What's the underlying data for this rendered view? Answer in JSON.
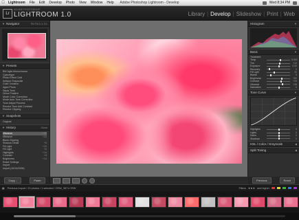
{
  "menubar": {
    "items": [
      "Lightroom",
      "File",
      "Edit",
      "Develop",
      "Photo",
      "View",
      "Window",
      "Help"
    ],
    "window_title": "Adobe Photoshop Lightroom - Develop",
    "clock": "Wed 8:34 PM"
  },
  "header": {
    "logo_letters": "Lr",
    "brand_small": "ADOBE PHOTOSHOP",
    "brand": "LIGHTROOM 1.0",
    "modules": [
      "Library",
      "Develop",
      "Slideshow",
      "Print",
      "Web"
    ],
    "active_module": "Develop"
  },
  "left_panel": {
    "navigator_label": "Navigator",
    "navigator_zoom": [
      "Fit",
      "Fill",
      "1:1",
      "3:1"
    ],
    "presets_label": "Presets",
    "presets": [
      "BW Agfa Monochrome",
      "Cyanotype",
      "Photo Effect Cold",
      "Antique Grayscale",
      "Color Creative",
      "Aged Photo",
      "Sepia Tone",
      "Direct Positive",
      "Mode Color Correction",
      "Mode Auto Tone Correction",
      "Tone Adjust Process",
      "Recolor Tone Add Contrast",
      "Recolor Clipping"
    ],
    "snapshots_label": "Snapshots",
    "snapshots": [
      "Original"
    ],
    "history_label": "History",
    "history_clear": "Clear",
    "history": [
      {
        "label": "Vibrance",
        "value": "+28"
      },
      {
        "label": "Vibrance",
        "value": "+20"
      },
      {
        "label": "Black Clipping",
        "value": ""
      },
      {
        "label": "Shadow Detail",
        "value": "+6"
      },
      {
        "label": "Fill Light",
        "value": "+20"
      },
      {
        "label": "Fill Light",
        "value": "+6"
      },
      {
        "label": "Highlights",
        "value": "+14"
      },
      {
        "label": "Contrast",
        "value": "+8"
      },
      {
        "label": "Brightness",
        "value": "+14"
      },
      {
        "label": "Reset Settings",
        "value": ""
      },
      {
        "label": "Import",
        "value": ""
      },
      {
        "label": "Import (10/14/2006)",
        "value": ""
      }
    ],
    "copy_button": "Copy...",
    "paste_button": "Paste"
  },
  "right_panel": {
    "histogram_label": "Histogram",
    "basic_label": "Basic",
    "basic_rows": [
      {
        "label": "Treatment",
        "value": ""
      },
      {
        "label": "Temp",
        "value": "6,500",
        "pos": 0.55
      },
      {
        "label": "Tint",
        "value": "+12",
        "pos": 0.52
      },
      {
        "label": "Exposure",
        "value": "0.00",
        "pos": 0.5
      },
      {
        "label": "Recovery",
        "value": "0",
        "pos": 0.1
      },
      {
        "label": "Fill Light",
        "value": "20",
        "pos": 0.3
      },
      {
        "label": "Blacks",
        "value": "5",
        "pos": 0.15
      },
      {
        "label": "Brightness",
        "value": "+50",
        "pos": 0.62
      },
      {
        "label": "Contrast",
        "value": "+25",
        "pos": 0.58
      },
      {
        "label": "Vibrance",
        "value": "+28",
        "pos": 0.64
      },
      {
        "label": "Saturation",
        "value": "0",
        "pos": 0.5
      }
    ],
    "tone_curve_label": "Tone Curve",
    "tone_rows": [
      {
        "label": "Highlights",
        "value": "0",
        "pos": 0.5
      },
      {
        "label": "Lights",
        "value": "0",
        "pos": 0.5
      },
      {
        "label": "Darks",
        "value": "0",
        "pos": 0.5
      },
      {
        "label": "Shadows",
        "value": "0",
        "pos": 0.5
      }
    ],
    "hsl_label": "HSL / Color / Grayscale",
    "split_toning_label": "Split Toning",
    "previous_button": "Previous",
    "reset_button": "Reset"
  },
  "filmbar": {
    "breadcrumb": "Previous Import / 20 photos / 1 selected / CRW_3871.CRW",
    "filters_label": "Filters",
    "rating_label": "and higher",
    "filter_colors": [
      "#d33",
      "#dd3",
      "#3b3",
      "#37d",
      "#a3d"
    ]
  },
  "filmstrip": {
    "thumbs": [
      {
        "color": "#e84e72",
        "selected": false
      },
      {
        "color": "#f2829c",
        "selected": true
      },
      {
        "color": "#d44a6a",
        "selected": false
      },
      {
        "color": "#e96a8a",
        "selected": false
      },
      {
        "color": "#b73a56",
        "selected": false
      },
      {
        "color": "#f07a96",
        "selected": false
      },
      {
        "color": "#c84562",
        "selected": false
      },
      {
        "color": "#e05a7c",
        "selected": false
      },
      {
        "color": "#e0e0e0",
        "selected": false
      },
      {
        "color": "#c44a62",
        "selected": false
      },
      {
        "color": "#ee8aa2",
        "selected": false
      },
      {
        "color": "#ff6a6a",
        "selected": false
      },
      {
        "color": "#c0c0c0",
        "selected": false
      },
      {
        "color": "#d85a78",
        "selected": false
      },
      {
        "color": "#f59ab0",
        "selected": false
      },
      {
        "color": "#e04a6a",
        "selected": false
      },
      {
        "color": "#d66a86",
        "selected": false
      },
      {
        "color": "#ea7090",
        "selected": false
      },
      {
        "color": "#b44c66",
        "selected": false
      }
    ]
  }
}
